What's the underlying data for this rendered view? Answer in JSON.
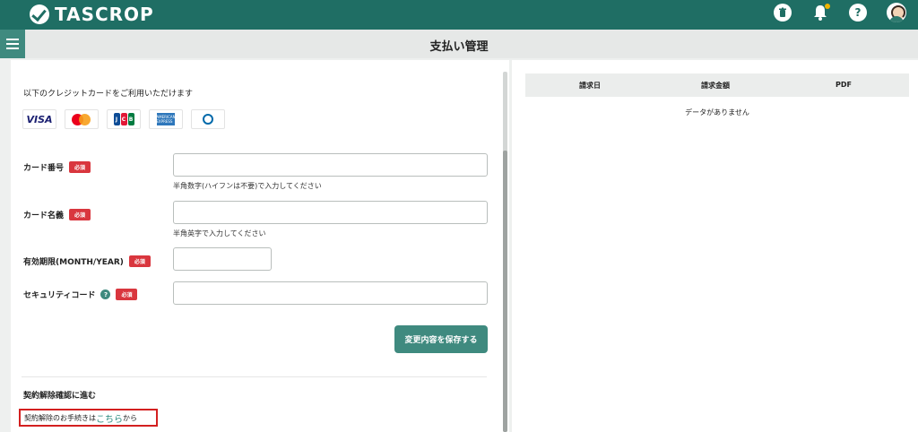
{
  "app": {
    "logo_text": "TASCROP"
  },
  "topbar": {
    "icons": [
      "trash-icon",
      "bell-icon",
      "help-icon",
      "avatar"
    ],
    "help_label": "?",
    "accent": "#1f6e64"
  },
  "page": {
    "title": "支払い管理"
  },
  "card_form": {
    "intro": "以下のクレジットカードをご利用いただけます",
    "brands": [
      {
        "name": "visa-icon",
        "label": "VISA"
      },
      {
        "name": "mastercard-icon"
      },
      {
        "name": "jcb-icon",
        "label": "JCB"
      },
      {
        "name": "amex-icon",
        "label": "AMERICAN EXPRESS"
      },
      {
        "name": "diners-icon"
      }
    ],
    "required_label": "必須",
    "fields": {
      "number": {
        "label": "カード番号",
        "hint": "半角数字(ハイフンは不要)で入力してください",
        "value": ""
      },
      "name": {
        "label": "カード名義",
        "hint": "半角英字で入力してください",
        "value": ""
      },
      "expiry": {
        "label": "有効期限(MONTH/YEAR)",
        "value": ""
      },
      "security": {
        "label": "セキュリティコード",
        "help": "?",
        "value": ""
      }
    },
    "save_label": "変更内容を保存する"
  },
  "cancellation": {
    "heading": "契約解除確認に進む",
    "text_prefix": "契約解除のお手続きは",
    "link_text": "こちら",
    "text_suffix": "から"
  },
  "billing": {
    "columns": [
      "請求日",
      "請求金額",
      "PDF"
    ],
    "empty_message": "データがありません"
  },
  "colors": {
    "primary": "#1f6e64",
    "button": "#3f8a7f",
    "required": "#d9363e",
    "highlight_border": "#d32020",
    "link": "#2a8a7e"
  }
}
